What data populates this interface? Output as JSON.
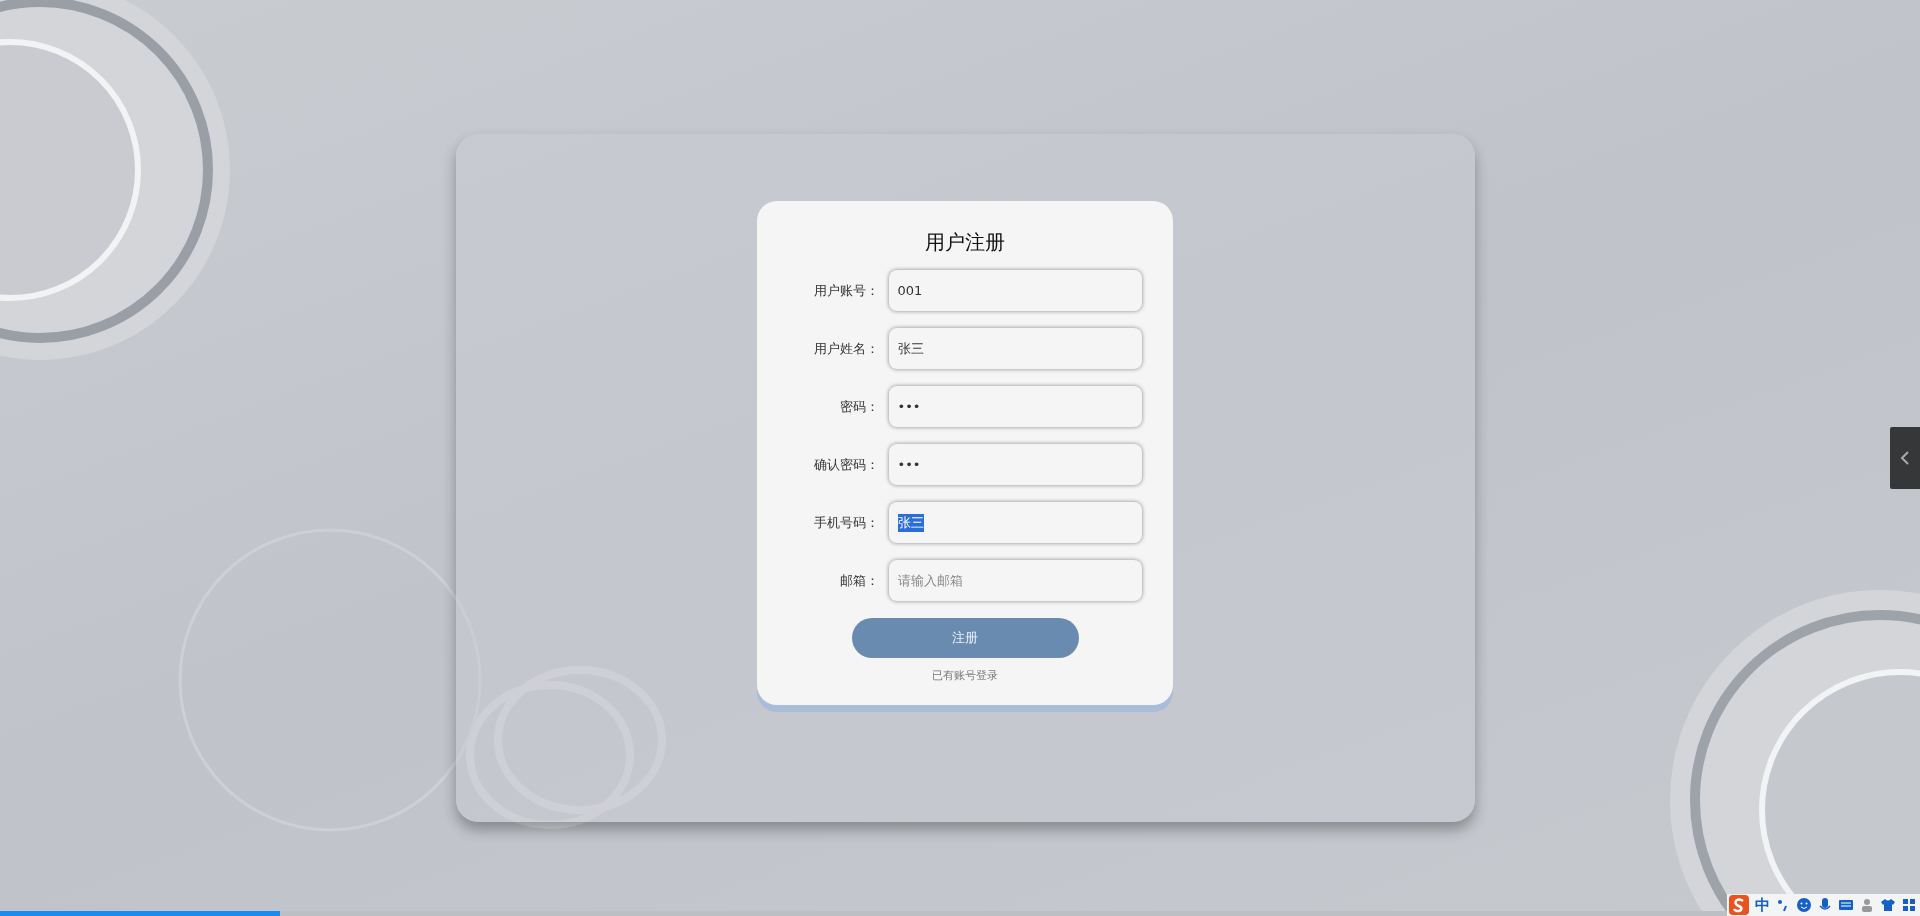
{
  "form": {
    "title": "用户注册",
    "fields": [
      {
        "label": "用户账号：",
        "value": "001",
        "text_selected": false
      },
      {
        "label": "用户姓名：",
        "value": "张三",
        "text_selected": false
      },
      {
        "label": "密码：",
        "value": "•••",
        "text_selected": false
      },
      {
        "label": "确认密码：",
        "value": "•••",
        "text_selected": false
      },
      {
        "label": "手机号码：",
        "value": "张三",
        "text_selected": true
      },
      {
        "label": "邮箱：",
        "placeholder": "请输入邮箱"
      }
    ],
    "submit": "注册",
    "login_link": "已有账号登录"
  },
  "playback": {
    "level": 0.146
  },
  "ime_toolbar": {
    "mode": "中"
  }
}
